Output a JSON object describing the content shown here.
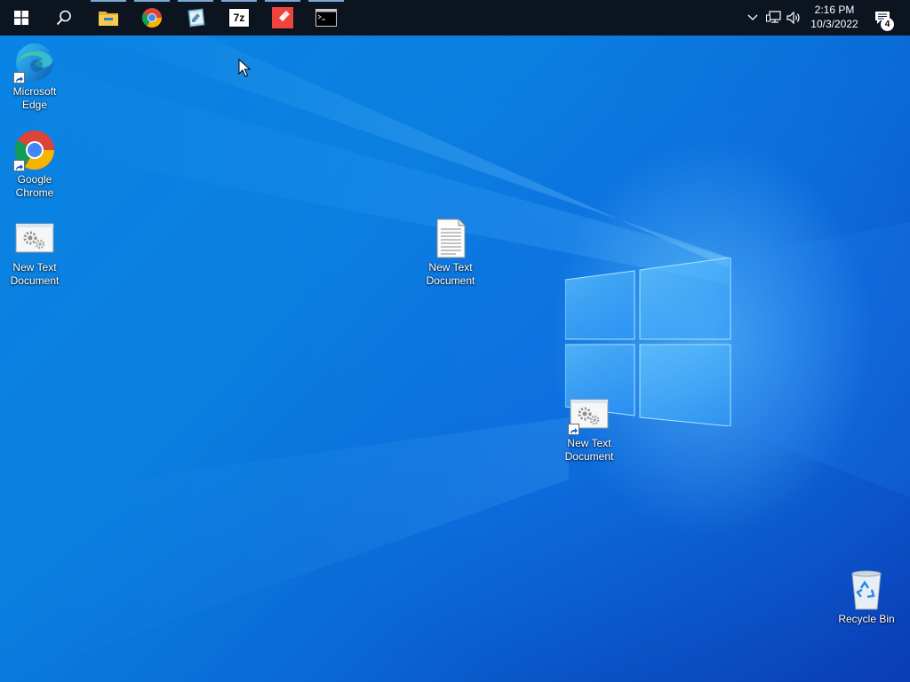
{
  "taskbar": {
    "start_icon": "windows-start-icon",
    "search_icon": "search-icon",
    "pinned": [
      {
        "name": "file-explorer",
        "icon": "folder-icon",
        "running": true
      },
      {
        "name": "google-chrome",
        "icon": "chrome-icon",
        "running": true
      },
      {
        "name": "notepad-app",
        "icon": "notepad-icon",
        "running": true
      },
      {
        "name": "7zip",
        "icon": "7zip-icon",
        "label": "7z",
        "running": true
      },
      {
        "name": "anydesk",
        "icon": "anydesk-icon",
        "running": true
      },
      {
        "name": "command-prompt",
        "icon": "terminal-icon",
        "running": true
      }
    ],
    "tray": {
      "overflow_icon": "chevron-up-icon",
      "network_icon": "network-icon",
      "volume_icon": "speaker-icon",
      "time": "2:16 PM",
      "date": "10/3/2022",
      "notification_icon": "action-center-icon",
      "notification_count": "4"
    }
  },
  "desktop": {
    "icons": [
      {
        "label": "Microsoft\nEdge",
        "icon": "edge-icon",
        "shortcut": true
      },
      {
        "label": "Google\nChrome",
        "icon": "chrome-icon",
        "shortcut": true
      },
      {
        "label": "New Text\nDocument",
        "icon": "settings-window-icon",
        "shortcut": false
      },
      {
        "label": "New Text\nDocument",
        "icon": "text-document-icon",
        "shortcut": false
      },
      {
        "label": "New Text\nDocument",
        "icon": "settings-window-icon",
        "shortcut": true
      },
      {
        "label": "Recycle Bin",
        "icon": "recycle-bin-icon",
        "shortcut": false
      }
    ]
  },
  "colors": {
    "taskbar_bg": "#0c1420",
    "desktop_blue": "#0a6fd6",
    "accent_running": "#7aa7d8"
  }
}
